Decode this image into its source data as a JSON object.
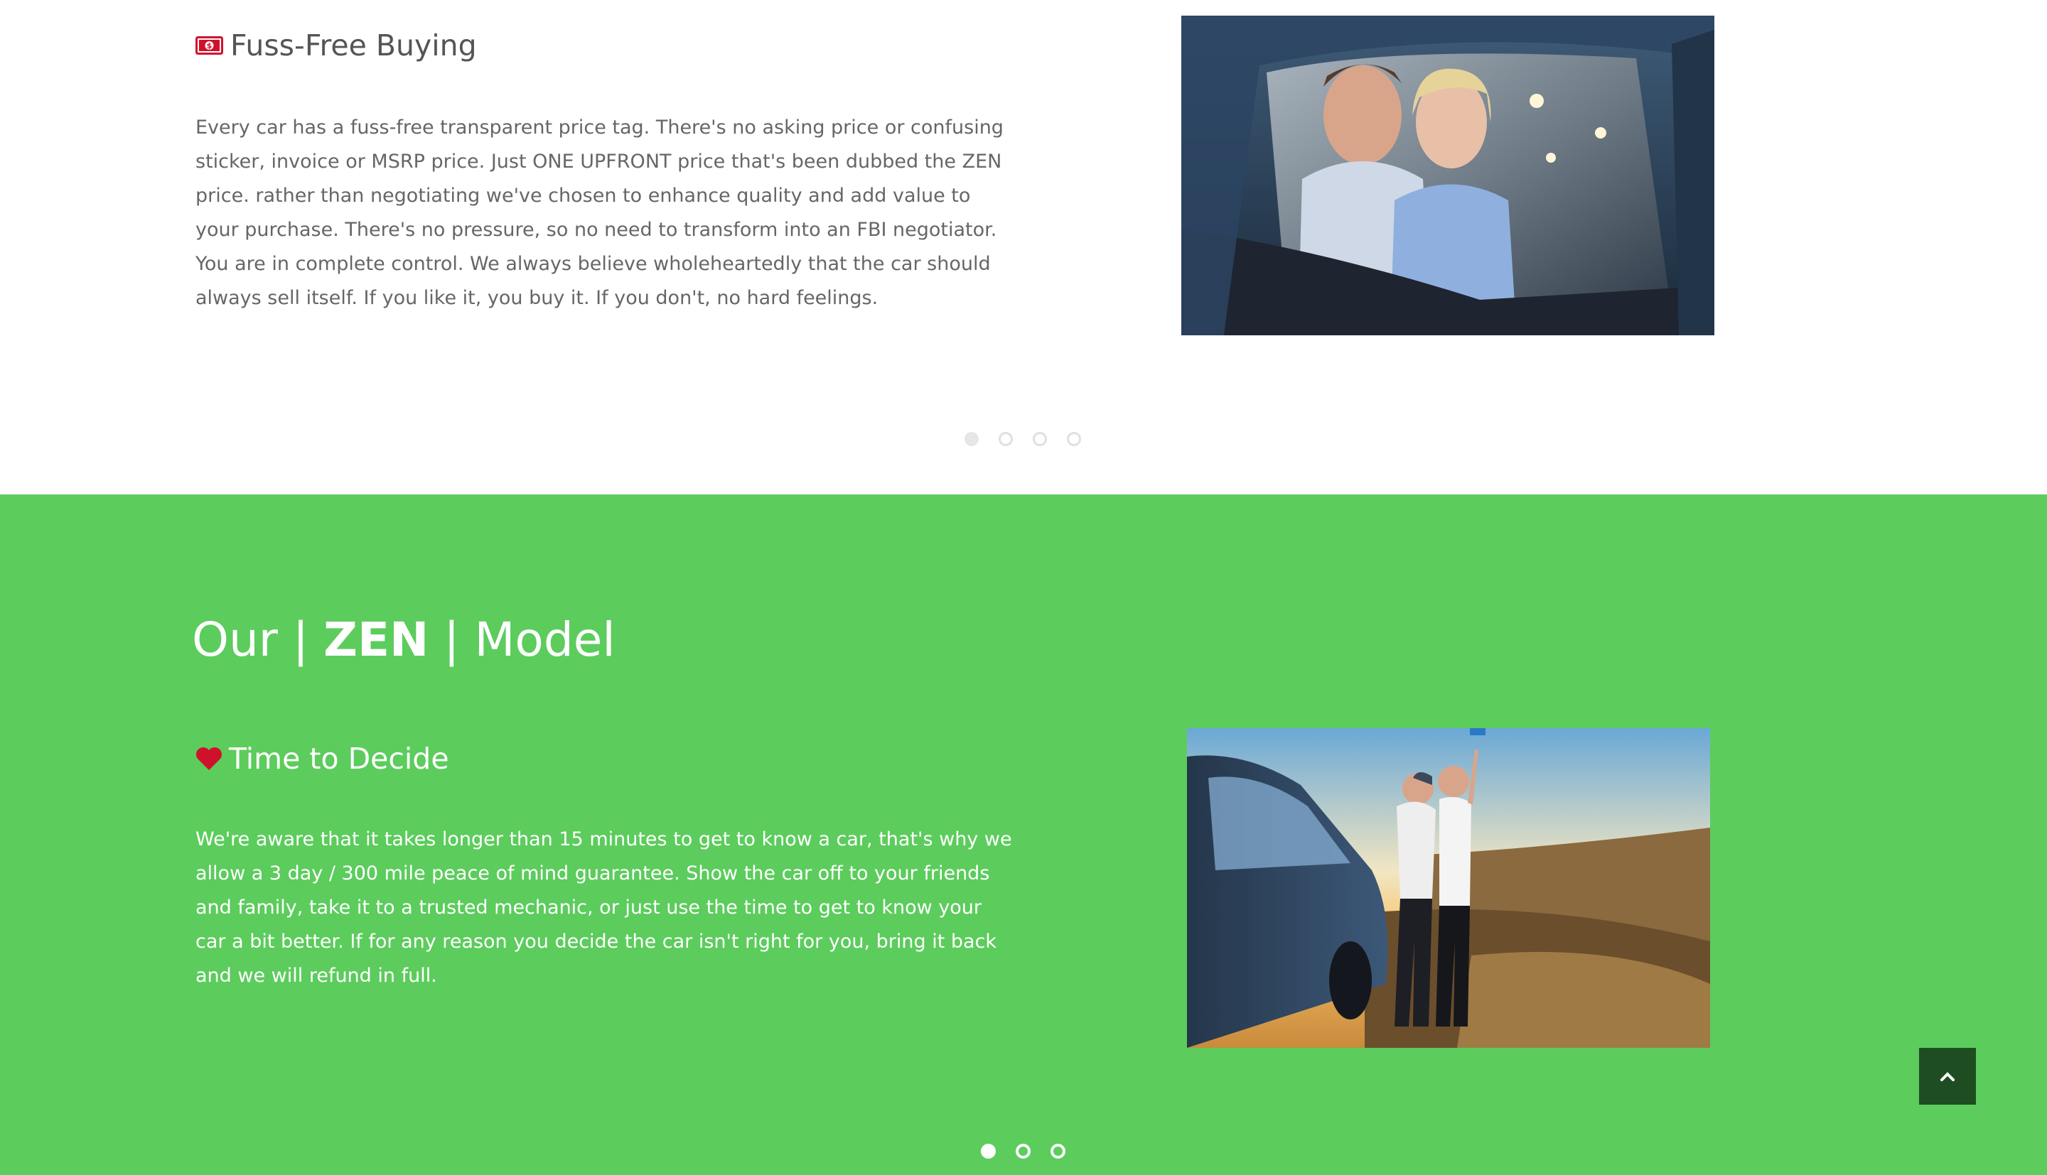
{
  "colors": {
    "green_background": "#5ccc5d",
    "back_to_top_background": "#1f4d22",
    "icon_red": "#d0112b",
    "body_text_gray": "#666666"
  },
  "section_fuss_free": {
    "icon": "money-bill-icon",
    "heading": "Fuss-Free Buying",
    "body": "Every car has a fuss-free transparent price tag. There's no asking price or confusing sticker, invoice or MSRP price. Just ONE UPFRONT price that's been dubbed the ZEN price. rather than negotiating we've chosen to enhance quality and add value to your purchase. There's no pressure, so no need to transform into an FBI negotiator. You are in complete control. We always believe wholeheartedly that the car should always sell itself. If you like it, you buy it. If you don't, no hard feelings.",
    "carousel": {
      "total_slides": 4,
      "active_slide": 1
    }
  },
  "section_zen_model": {
    "title_part1": "Our | ",
    "title_bold": "ZEN",
    "title_part2": " | Model",
    "icon": "heart-icon",
    "heading": "Time to Decide",
    "body": "We're aware that it takes longer than 15 minutes to get to know a car, that's why we allow a 3 day / 300 mile peace of mind guarantee. Show the car off to your friends and family, take it to a trusted mechanic, or just use the time to get to know your car a bit better. If for any reason you decide the car isn't right for you, bring it back and we will refund in full.",
    "carousel": {
      "total_slides": 3,
      "active_slide": 1
    }
  },
  "back_to_top": {
    "icon": "chevron-up-icon"
  }
}
